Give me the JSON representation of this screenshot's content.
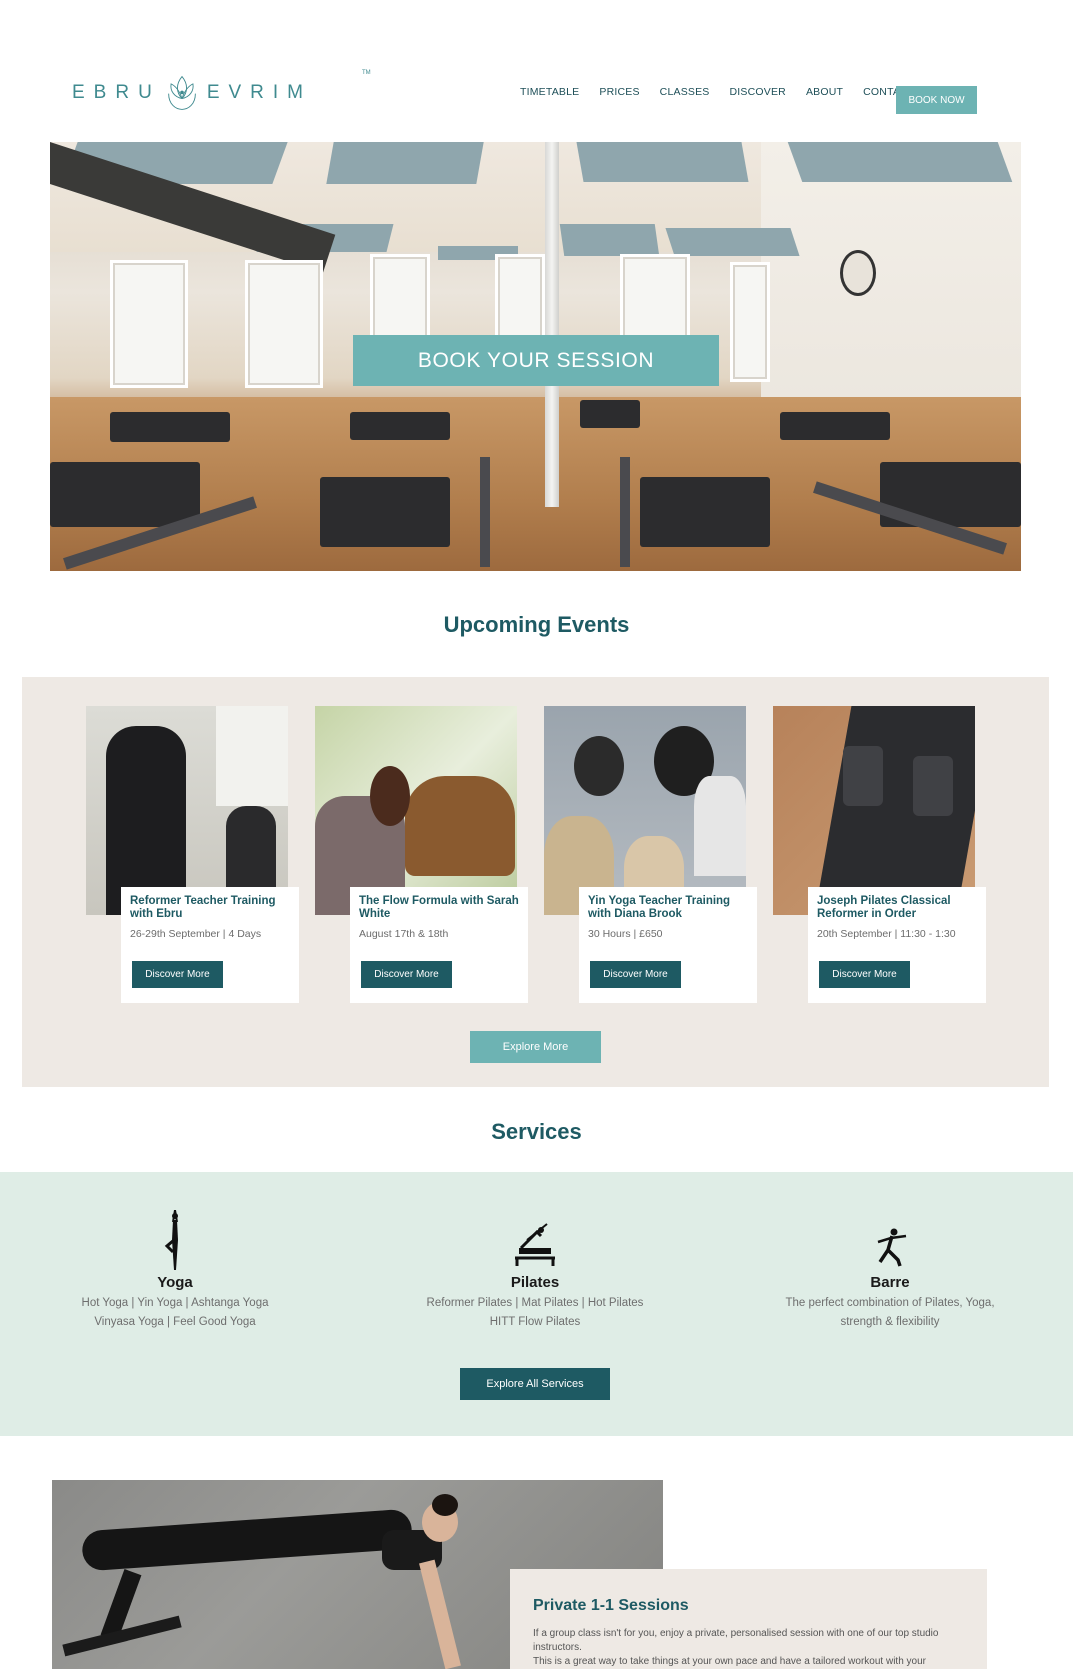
{
  "brand": {
    "left": "EBRU",
    "right": "EVRIM",
    "tm": "TM"
  },
  "nav": {
    "items": [
      "TIMETABLE",
      "PRICES",
      "CLASSES",
      "DISCOVER",
      "ABOUT",
      "CONTACT"
    ],
    "book_now": "BOOK NOW"
  },
  "hero": {
    "cta": "BOOK YOUR SESSION"
  },
  "events": {
    "title": "Upcoming Events",
    "items": [
      {
        "title": "Reformer Teacher Training with Ebru",
        "meta": "26-29th September | 4 Days",
        "button": "Discover More"
      },
      {
        "title": "The Flow Formula with Sarah White",
        "meta": "August 17th & 18th",
        "button": "Discover More"
      },
      {
        "title": "Yin Yoga Teacher Training with Diana Brook",
        "meta": "30 Hours | £650",
        "button": "Discover More"
      },
      {
        "title": "Joseph Pilates Classical Reformer in Order",
        "meta": "20th September | 11:30 - 1:30",
        "button": "Discover More"
      }
    ],
    "explore": "Explore More"
  },
  "services": {
    "title": "Services",
    "items": [
      {
        "title": "Yoga",
        "line1": "Hot Yoga | Yin Yoga | Ashtanga Yoga",
        "line2": "Vinyasa Yoga | Feel Good Yoga",
        "icon": "yoga-pose-icon"
      },
      {
        "title": "Pilates",
        "line1": "Reformer Pilates | Mat Pilates | Hot Pilates",
        "line2": "HITT Flow Pilates",
        "icon": "reformer-icon"
      },
      {
        "title": "Barre",
        "line1": "The perfect combination of Pilates, Yoga,",
        "line2": "strength & flexibility",
        "icon": "barre-pose-icon"
      }
    ],
    "explore": "Explore All Services"
  },
  "private": {
    "title": "Private 1-1 Sessions",
    "line1": "If a group class isn't for you, enjoy a private, personalised session with one of our top studio",
    "line2": "instructors.",
    "line3": "This is a great way to take things at your own pace and have a tailored workout with your"
  },
  "colors": {
    "brand_teal": "#6db3b3",
    "dark_teal": "#1e5a63",
    "beige": "#eee9e4",
    "mint": "#dfede6"
  }
}
